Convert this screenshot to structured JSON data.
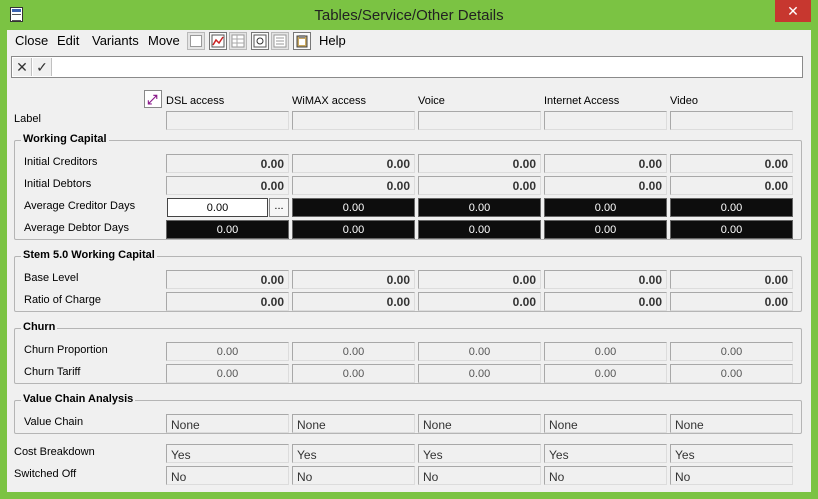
{
  "window": {
    "title": "Tables/Service/Other Details",
    "close_glyph": "✕"
  },
  "menu": {
    "close": "Close",
    "edit": "Edit",
    "variants": "Variants",
    "move": "Move",
    "help": "Help"
  },
  "toolbar_icons": [
    "edit-icon",
    "chart-icon",
    "grid-icon",
    "find-icon",
    "list-icon",
    "clipboard-icon"
  ],
  "editbar": {
    "cancel_glyph": "✕",
    "accept_glyph": "✓",
    "value": ""
  },
  "columns": [
    "DSL access",
    "WiMAX access",
    "Voice",
    "Internet Access",
    "Video"
  ],
  "label_row": {
    "label": "Label",
    "values": [
      "",
      "",
      "",
      "",
      ""
    ]
  },
  "working_capital": {
    "title": "Working Capital",
    "initial_creditors": {
      "label": "Initial Creditors",
      "values": [
        "0.00",
        "0.00",
        "0.00",
        "0.00",
        "0.00"
      ]
    },
    "initial_debtors": {
      "label": "Initial Debtors",
      "values": [
        "0.00",
        "0.00",
        "0.00",
        "0.00",
        "0.00"
      ]
    },
    "avg_creditor_days": {
      "label": "Average Creditor Days",
      "values": [
        "0.00",
        "0.00",
        "0.00",
        "0.00",
        "0.00"
      ]
    },
    "avg_debtor_days": {
      "label": "Average Debtor Days",
      "values": [
        "0.00",
        "0.00",
        "0.00",
        "0.00",
        "0.00"
      ]
    },
    "dots": "..."
  },
  "stem": {
    "title": "Stem 5.0 Working Capital",
    "base_level": {
      "label": "Base Level",
      "values": [
        "0.00",
        "0.00",
        "0.00",
        "0.00",
        "0.00"
      ]
    },
    "ratio_of_charge": {
      "label": "Ratio of Charge",
      "values": [
        "0.00",
        "0.00",
        "0.00",
        "0.00",
        "0.00"
      ]
    }
  },
  "churn": {
    "title": "Churn",
    "proportion": {
      "label": "Churn Proportion",
      "values": [
        "0.00",
        "0.00",
        "0.00",
        "0.00",
        "0.00"
      ]
    },
    "tariff": {
      "label": "Churn Tariff",
      "values": [
        "0.00",
        "0.00",
        "0.00",
        "0.00",
        "0.00"
      ]
    }
  },
  "value_chain": {
    "title": "Value Chain Analysis",
    "value_chain": {
      "label": "Value Chain",
      "values": [
        "None",
        "None",
        "None",
        "None",
        "None"
      ]
    }
  },
  "cost_breakdown": {
    "label": "Cost Breakdown",
    "values": [
      "Yes",
      "Yes",
      "Yes",
      "Yes",
      "Yes"
    ]
  },
  "switched_off": {
    "label": "Switched Off",
    "values": [
      "No",
      "No",
      "No",
      "No",
      "No"
    ]
  },
  "colors": {
    "window_frame": "#7bc343",
    "close_button": "#c7372f",
    "field_black": "#0d0d0d",
    "client_bg": "#f0f0f0"
  }
}
